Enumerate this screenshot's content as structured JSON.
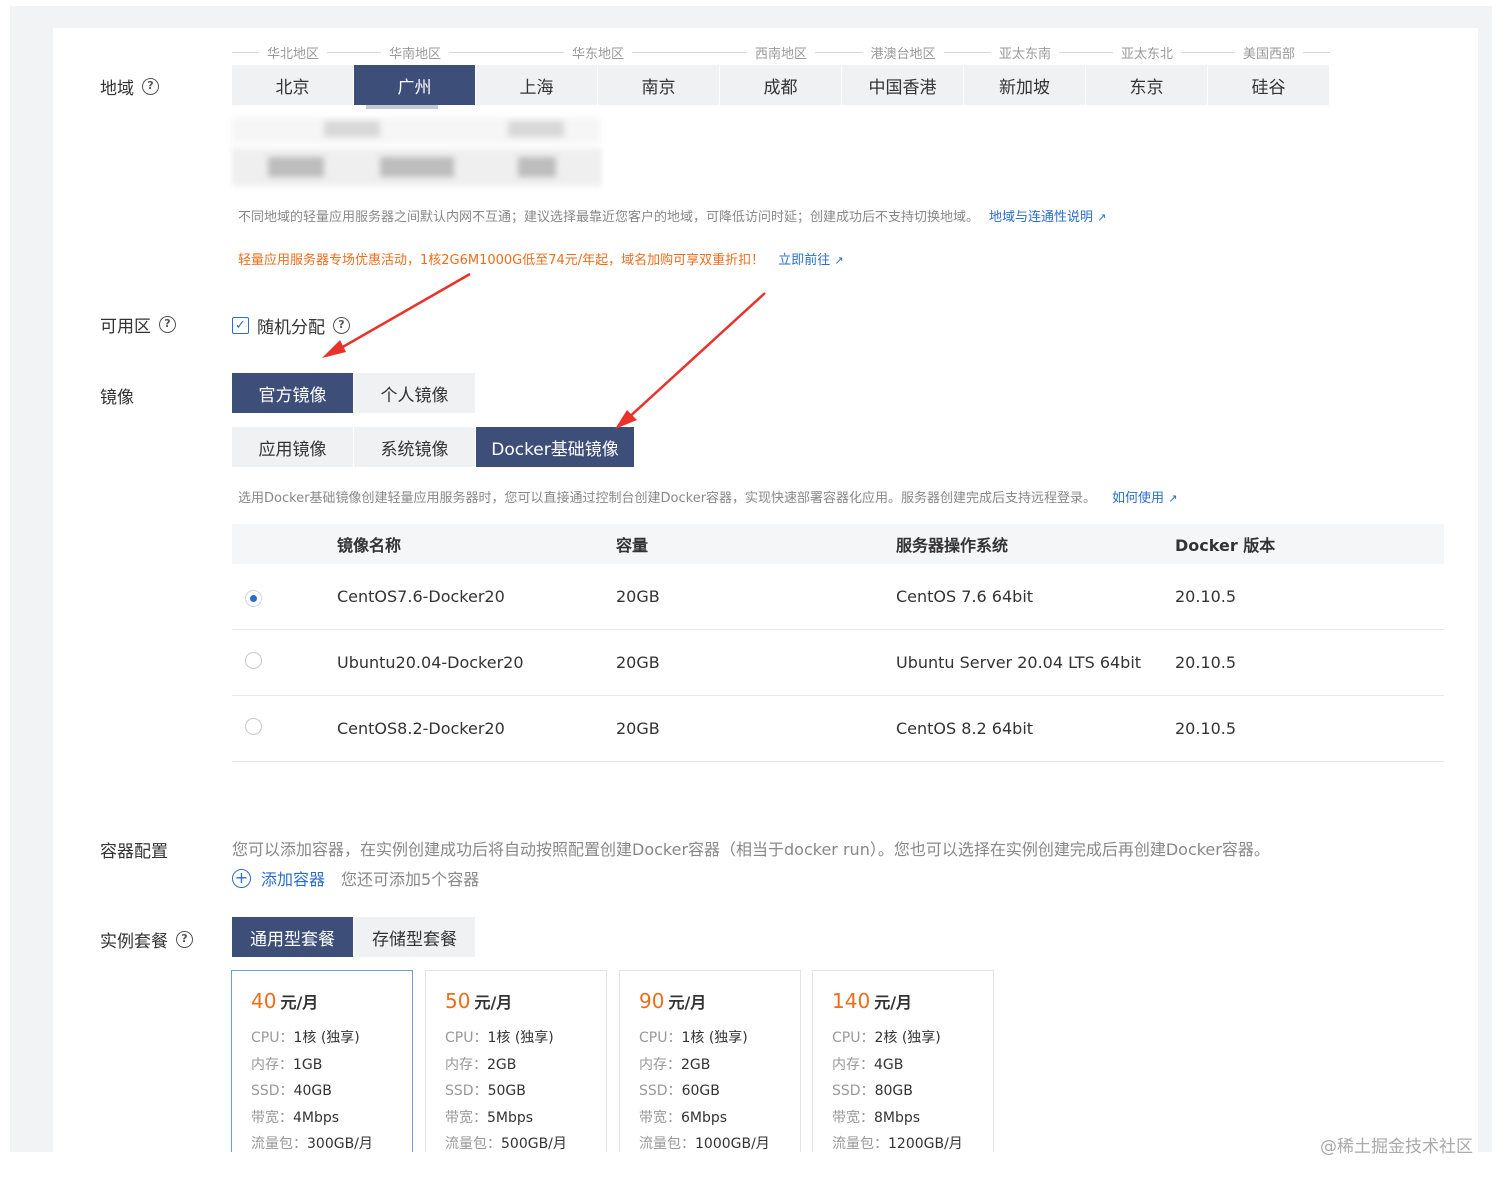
{
  "labels": {
    "region": "地域",
    "zone": "可用区",
    "image": "镜像",
    "container_config": "容器配置",
    "instance_plan": "实例套餐"
  },
  "region": {
    "groups": [
      "华北地区",
      "华南地区",
      "华东地区",
      "西南地区",
      "港澳台地区",
      "亚太东南",
      "亚太东北",
      "美国西部"
    ],
    "tabs": [
      "北京",
      "广州",
      "上海",
      "南京",
      "成都",
      "中国香港",
      "新加坡",
      "东京",
      "硅谷"
    ],
    "selected": "广州",
    "hint": "不同地域的轻量应用服务器之间默认内网不互通；建议选择最靠近您客户的地域，可降低访问时延；创建成功后不支持切换地域。",
    "hint_link": "地域与连通性说明",
    "promo": "轻量应用服务器专场优惠活动，1核2G6M1000G低至74元/年起，域名加购可享双重折扣！",
    "promo_link": "立即前往"
  },
  "zone": {
    "checkbox_label": "随机分配",
    "checked": true
  },
  "image": {
    "source_tabs": [
      "官方镜像",
      "个人镜像"
    ],
    "source_selected": "官方镜像",
    "type_tabs": [
      "应用镜像",
      "系统镜像",
      "Docker基础镜像"
    ],
    "type_selected": "Docker基础镜像",
    "hint": "选用Docker基础镜像创建轻量应用服务器时，您可以直接通过控制台创建Docker容器，实现快速部署容器化应用。服务器创建完成后支持远程登录。",
    "hint_link": "如何使用",
    "table": {
      "headers": [
        "镜像名称",
        "容量",
        "服务器操作系统",
        "Docker 版本"
      ],
      "rows": [
        {
          "name": "CentOS7.6-Docker20",
          "size": "20GB",
          "os": "CentOS 7.6 64bit",
          "docker": "20.10.5",
          "selected": true
        },
        {
          "name": "Ubuntu20.04-Docker20",
          "size": "20GB",
          "os": "Ubuntu Server 20.04 LTS 64bit",
          "docker": "20.10.5",
          "selected": false
        },
        {
          "name": "CentOS8.2-Docker20",
          "size": "20GB",
          "os": "CentOS 8.2 64bit",
          "docker": "20.10.5",
          "selected": false
        }
      ]
    }
  },
  "container": {
    "description": "您可以添加容器，在实例创建成功后将自动按照配置创建Docker容器（相当于docker run）。您也可以选择在实例创建完成后再创建Docker容器。",
    "add_label": "添加容器",
    "remaining": "您还可添加5个容器"
  },
  "plans": {
    "tabs": [
      "通用型套餐",
      "存储型套餐"
    ],
    "selected_tab": "通用型套餐",
    "unit": "元/月",
    "spec_keys": {
      "cpu": "CPU：",
      "mem": "内存：",
      "ssd": "SSD：",
      "bw": "带宽：",
      "traffic": "流量包："
    },
    "cards": [
      {
        "price": "40",
        "cpu": "1核 (独享)",
        "mem": "1GB",
        "ssd": "40GB",
        "bw": "4Mbps",
        "traffic": "300GB/月",
        "selected": true
      },
      {
        "price": "50",
        "cpu": "1核 (独享)",
        "mem": "2GB",
        "ssd": "50GB",
        "bw": "5Mbps",
        "traffic": "500GB/月",
        "selected": false
      },
      {
        "price": "90",
        "cpu": "1核 (独享)",
        "mem": "2GB",
        "ssd": "60GB",
        "bw": "6Mbps",
        "traffic": "1000GB/月",
        "selected": false
      },
      {
        "price": "140",
        "cpu": "2核 (独享)",
        "mem": "4GB",
        "ssd": "80GB",
        "bw": "8Mbps",
        "traffic": "1200GB/月",
        "selected": false
      }
    ]
  },
  "watermark": "@稀土掘金技术社区",
  "colors": {
    "primary_dark": "#3d4e79",
    "link": "#2a6ec9",
    "price": "#ee6d1c",
    "annotation_arrow": "#e8322b"
  }
}
